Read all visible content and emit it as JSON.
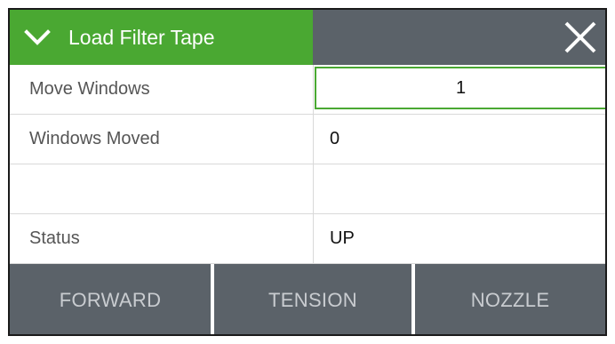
{
  "header": {
    "title": "Load Filter Tape",
    "collapse_icon": "chevron-down-icon",
    "close_icon": "close-icon",
    "accent_color": "#4aa832",
    "bar_color": "#5b6269"
  },
  "rows": [
    {
      "label": "Move Windows",
      "value": "1"
    },
    {
      "label": "Windows Moved",
      "value": "0"
    },
    {
      "label": "",
      "value": ""
    },
    {
      "label": "Status",
      "value": "UP"
    }
  ],
  "footer": {
    "buttons": [
      "FORWARD",
      "TENSION",
      "NOZZLE"
    ]
  }
}
